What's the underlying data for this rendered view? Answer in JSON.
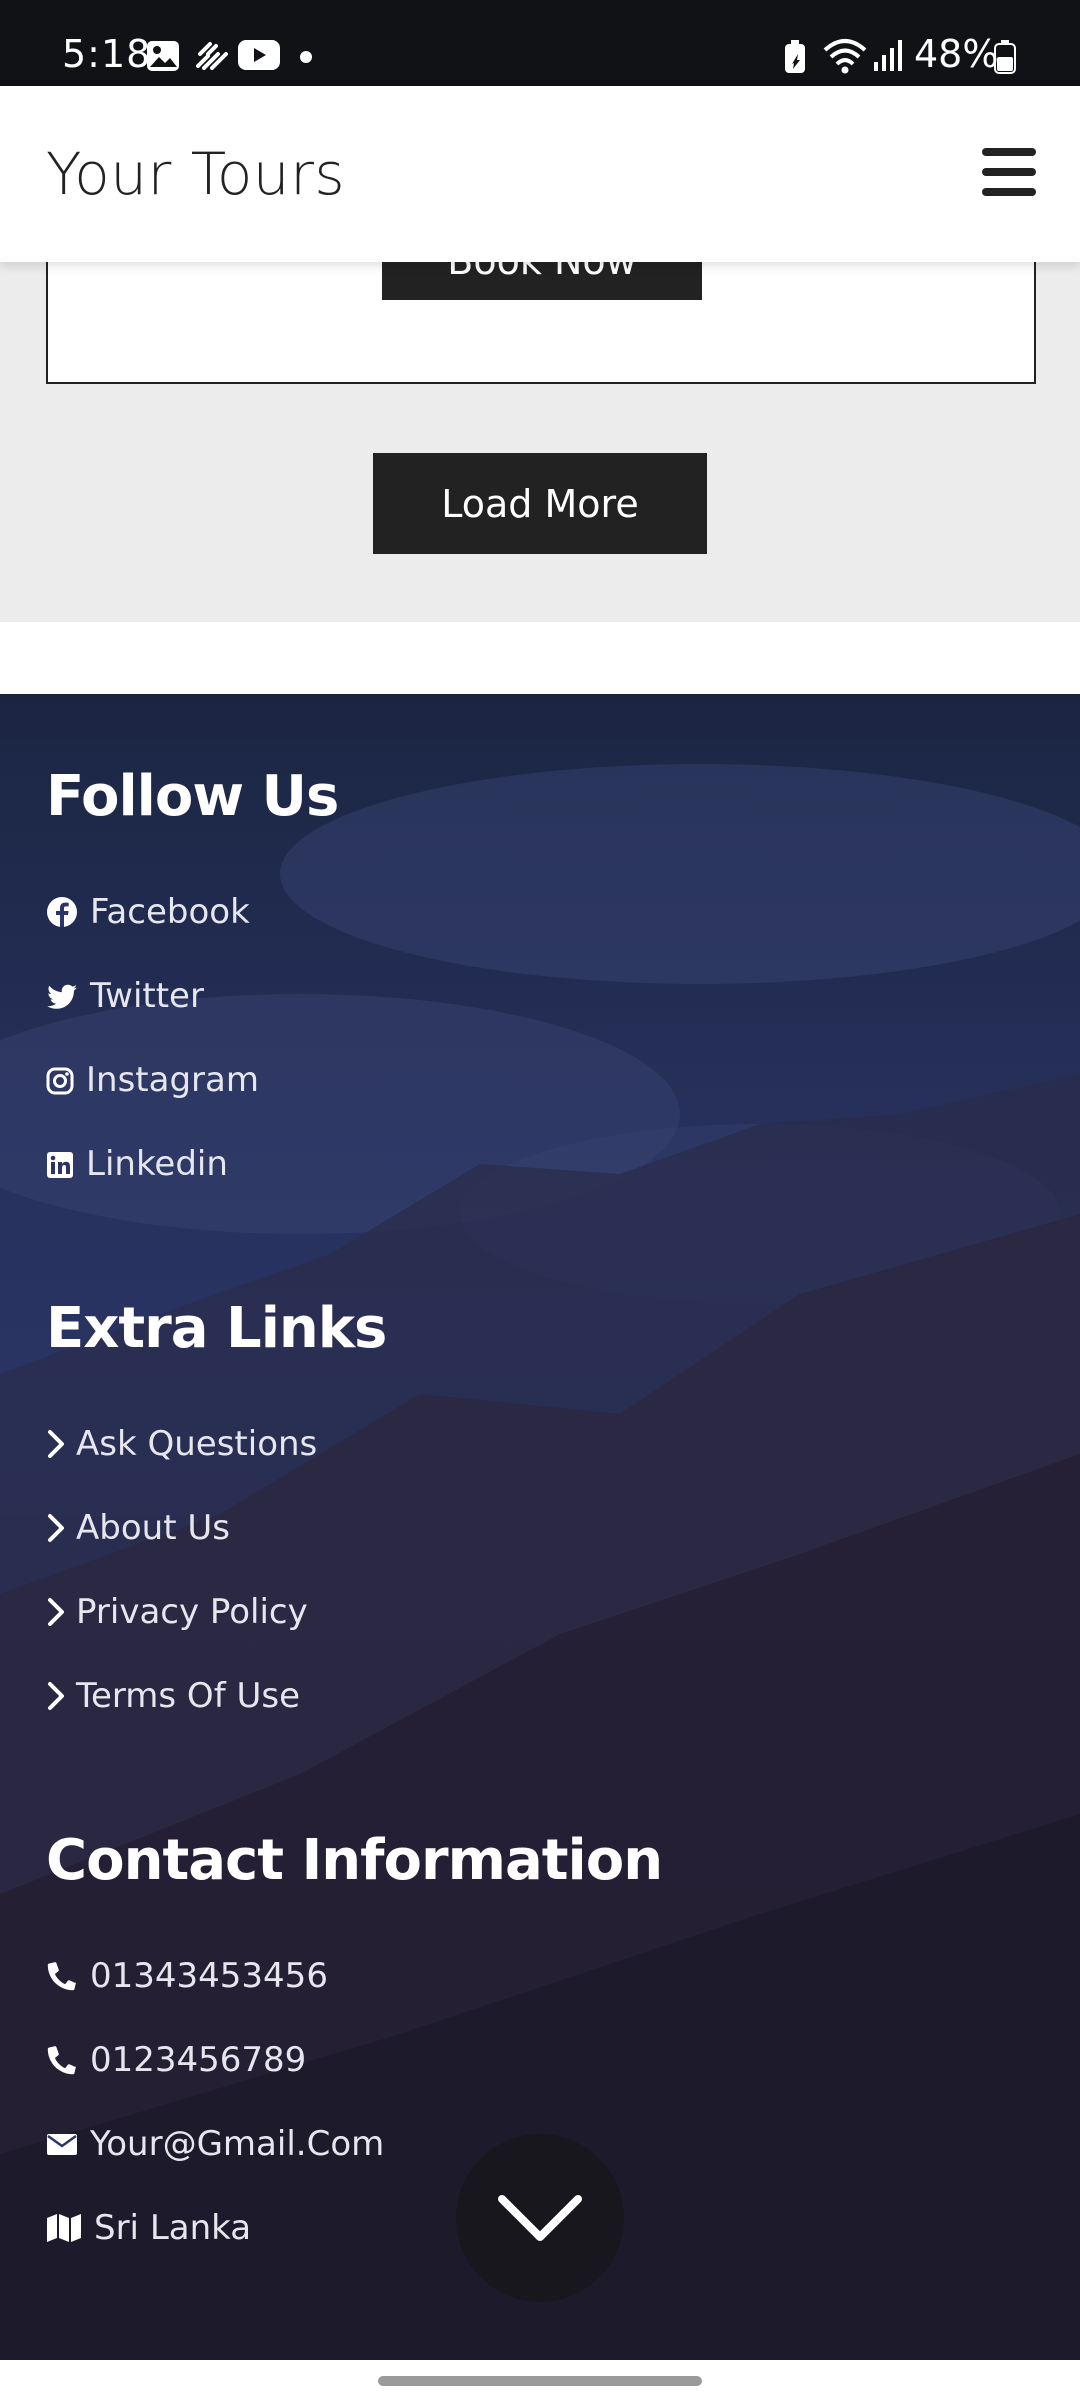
{
  "status_bar": {
    "time": "5:18",
    "battery_percent": "48%",
    "left_icons": [
      "gallery-icon",
      "app-notification-icon",
      "youtube-icon",
      "dot-icon"
    ],
    "right_icons": [
      "battery-saver-icon",
      "wifi-icon",
      "signal-icon",
      "battery-icon"
    ]
  },
  "header": {
    "brand": "Your Tours",
    "menu_icon": "hamburger-menu-icon"
  },
  "tour_card": {
    "book_label": "Book Now"
  },
  "load_more_label": "Load More",
  "footer": {
    "follow": {
      "title": "Follow Us",
      "items": [
        {
          "label": "Facebook",
          "icon": "facebook-icon"
        },
        {
          "label": "Twitter",
          "icon": "twitter-icon"
        },
        {
          "label": "Instagram",
          "icon": "instagram-icon"
        },
        {
          "label": "Linkedin",
          "icon": "linkedin-icon"
        }
      ]
    },
    "extra": {
      "title": "Extra Links",
      "items": [
        {
          "label": "Ask Questions"
        },
        {
          "label": "About Us"
        },
        {
          "label": "Privacy Policy"
        },
        {
          "label": "Terms Of Use"
        }
      ]
    },
    "contact": {
      "title": "Contact Information",
      "items": [
        {
          "label": "01343453456",
          "icon": "phone-icon"
        },
        {
          "label": "0123456789",
          "icon": "phone-icon"
        },
        {
          "label": "Your@Gmail.Com",
          "icon": "envelope-icon"
        },
        {
          "label": "Sri Lanka",
          "icon": "map-icon"
        }
      ]
    }
  },
  "scroll_button_icon": "chevron-down-icon",
  "colors": {
    "dark_button": "#222222",
    "footer_bg": "#2b3566",
    "page_bg": "#ececec"
  }
}
